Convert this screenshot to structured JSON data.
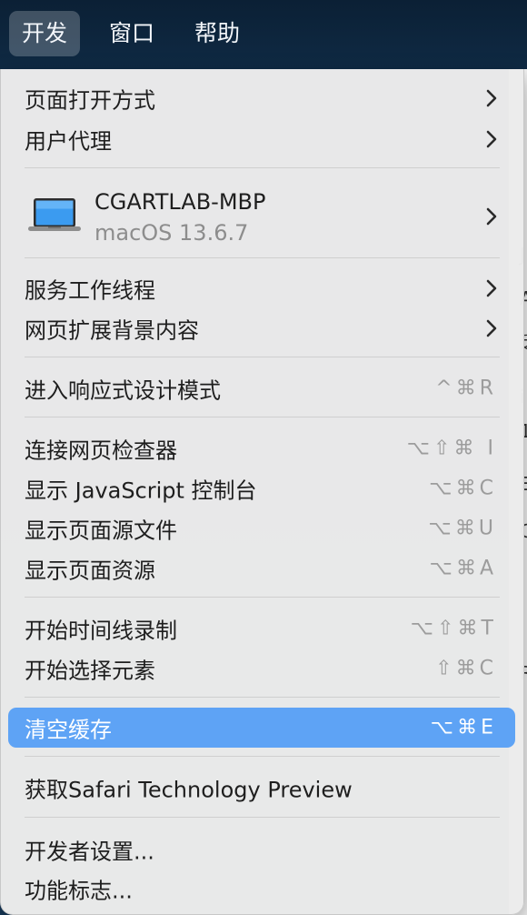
{
  "menubar": {
    "items": [
      "开发",
      "窗口",
      "帮助"
    ]
  },
  "menu": {
    "open_page_with": "页面打开方式",
    "user_agent": "用户代理",
    "device": {
      "name": "CGARTLAB-MBP",
      "os": "macOS 13.6.7"
    },
    "service_workers": "服务工作线程",
    "web_extension_background": "网页扩展背景内容",
    "responsive_design": {
      "label": "进入响应式设计模式",
      "shortcut": "^⌘R"
    },
    "web_inspector": {
      "label": "连接网页检查器",
      "shortcut": "⌥⇧⌘ I"
    },
    "js_console": {
      "label": "显示 JavaScript 控制台",
      "shortcut": "⌥⌘C"
    },
    "page_source": {
      "label": "显示页面源文件",
      "shortcut": "⌥⌘U"
    },
    "page_resources": {
      "label": "显示页面资源",
      "shortcut": "⌥⌘A"
    },
    "timeline_recording": {
      "label": "开始时间线录制",
      "shortcut": "⌥⇧⌘T"
    },
    "select_element": {
      "label": "开始选择元素",
      "shortcut": "⇧⌘C"
    },
    "empty_caches": {
      "label": "清空缓存",
      "shortcut": "⌥⌘E"
    },
    "get_stp": "获取Safari Technology Preview",
    "developer_settings": "开发者设置...",
    "feature_flags": "功能标志..."
  },
  "background_glyphs": [
    "J",
    "A",
    "乏",
    "i",
    "1",
    "E",
    "C",
    "R"
  ],
  "colors": {
    "highlight": "#5ea3f5",
    "menu_bg": "#ececec",
    "menubar_bg": "#0f2a44"
  }
}
